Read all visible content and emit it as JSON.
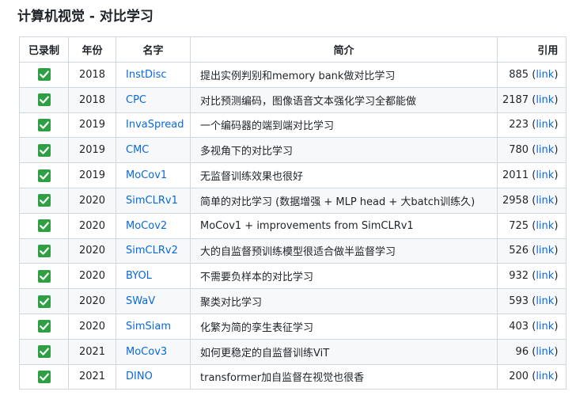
{
  "heading": "计算机视觉 - 对比学习",
  "columns": [
    "已录制",
    "年份",
    "名字",
    "简介",
    "引用"
  ],
  "link_label": "link",
  "colors": {
    "check": "#2ea043",
    "link": "#0969da",
    "border": "#d0d7de",
    "stripe": "#f6f8fa"
  },
  "rows": [
    {
      "recorded_icon": "check-mark-icon",
      "year": "2018",
      "name": "InstDisc",
      "desc": "提出实例判别和memory bank做对比学习",
      "cites": "885"
    },
    {
      "recorded_icon": "check-mark-icon",
      "year": "2018",
      "name": "CPC",
      "desc": "对比预测编码，图像语音文本强化学习全都能做",
      "cites": "2187"
    },
    {
      "recorded_icon": "check-mark-icon",
      "year": "2019",
      "name": "InvaSpread",
      "desc": "一个编码器的端到端对比学习",
      "cites": "223"
    },
    {
      "recorded_icon": "check-mark-icon",
      "year": "2019",
      "name": "CMC",
      "desc": "多视角下的对比学习",
      "cites": "780"
    },
    {
      "recorded_icon": "check-mark-icon",
      "year": "2019",
      "name": "MoCov1",
      "desc": "无监督训练效果也很好",
      "cites": "2011"
    },
    {
      "recorded_icon": "check-mark-icon",
      "year": "2020",
      "name": "SimCLRv1",
      "desc": "简单的对比学习 (数据增强 + MLP head + 大batch训练久)",
      "cites": "2958"
    },
    {
      "recorded_icon": "check-mark-icon",
      "year": "2020",
      "name": "MoCov2",
      "desc": "MoCov1 + improvements from SimCLRv1",
      "cites": "725"
    },
    {
      "recorded_icon": "check-mark-icon",
      "year": "2020",
      "name": "SimCLRv2",
      "desc": "大的自监督预训练模型很适合做半监督学习",
      "cites": "526"
    },
    {
      "recorded_icon": "check-mark-icon",
      "year": "2020",
      "name": "BYOL",
      "desc": "不需要负样本的对比学习",
      "cites": "932"
    },
    {
      "recorded_icon": "check-mark-icon",
      "year": "2020",
      "name": "SWaV",
      "desc": "聚类对比学习",
      "cites": "593"
    },
    {
      "recorded_icon": "check-mark-icon",
      "year": "2020",
      "name": "SimSiam",
      "desc": "化繁为简的孪生表征学习",
      "cites": "403"
    },
    {
      "recorded_icon": "check-mark-icon",
      "year": "2021",
      "name": "MoCov3",
      "desc": "如何更稳定的自监督训练ViT",
      "cites": "96"
    },
    {
      "recorded_icon": "check-mark-icon",
      "year": "2021",
      "name": "DINO",
      "desc": "transformer加自监督在视觉也很香",
      "cites": "200"
    }
  ]
}
